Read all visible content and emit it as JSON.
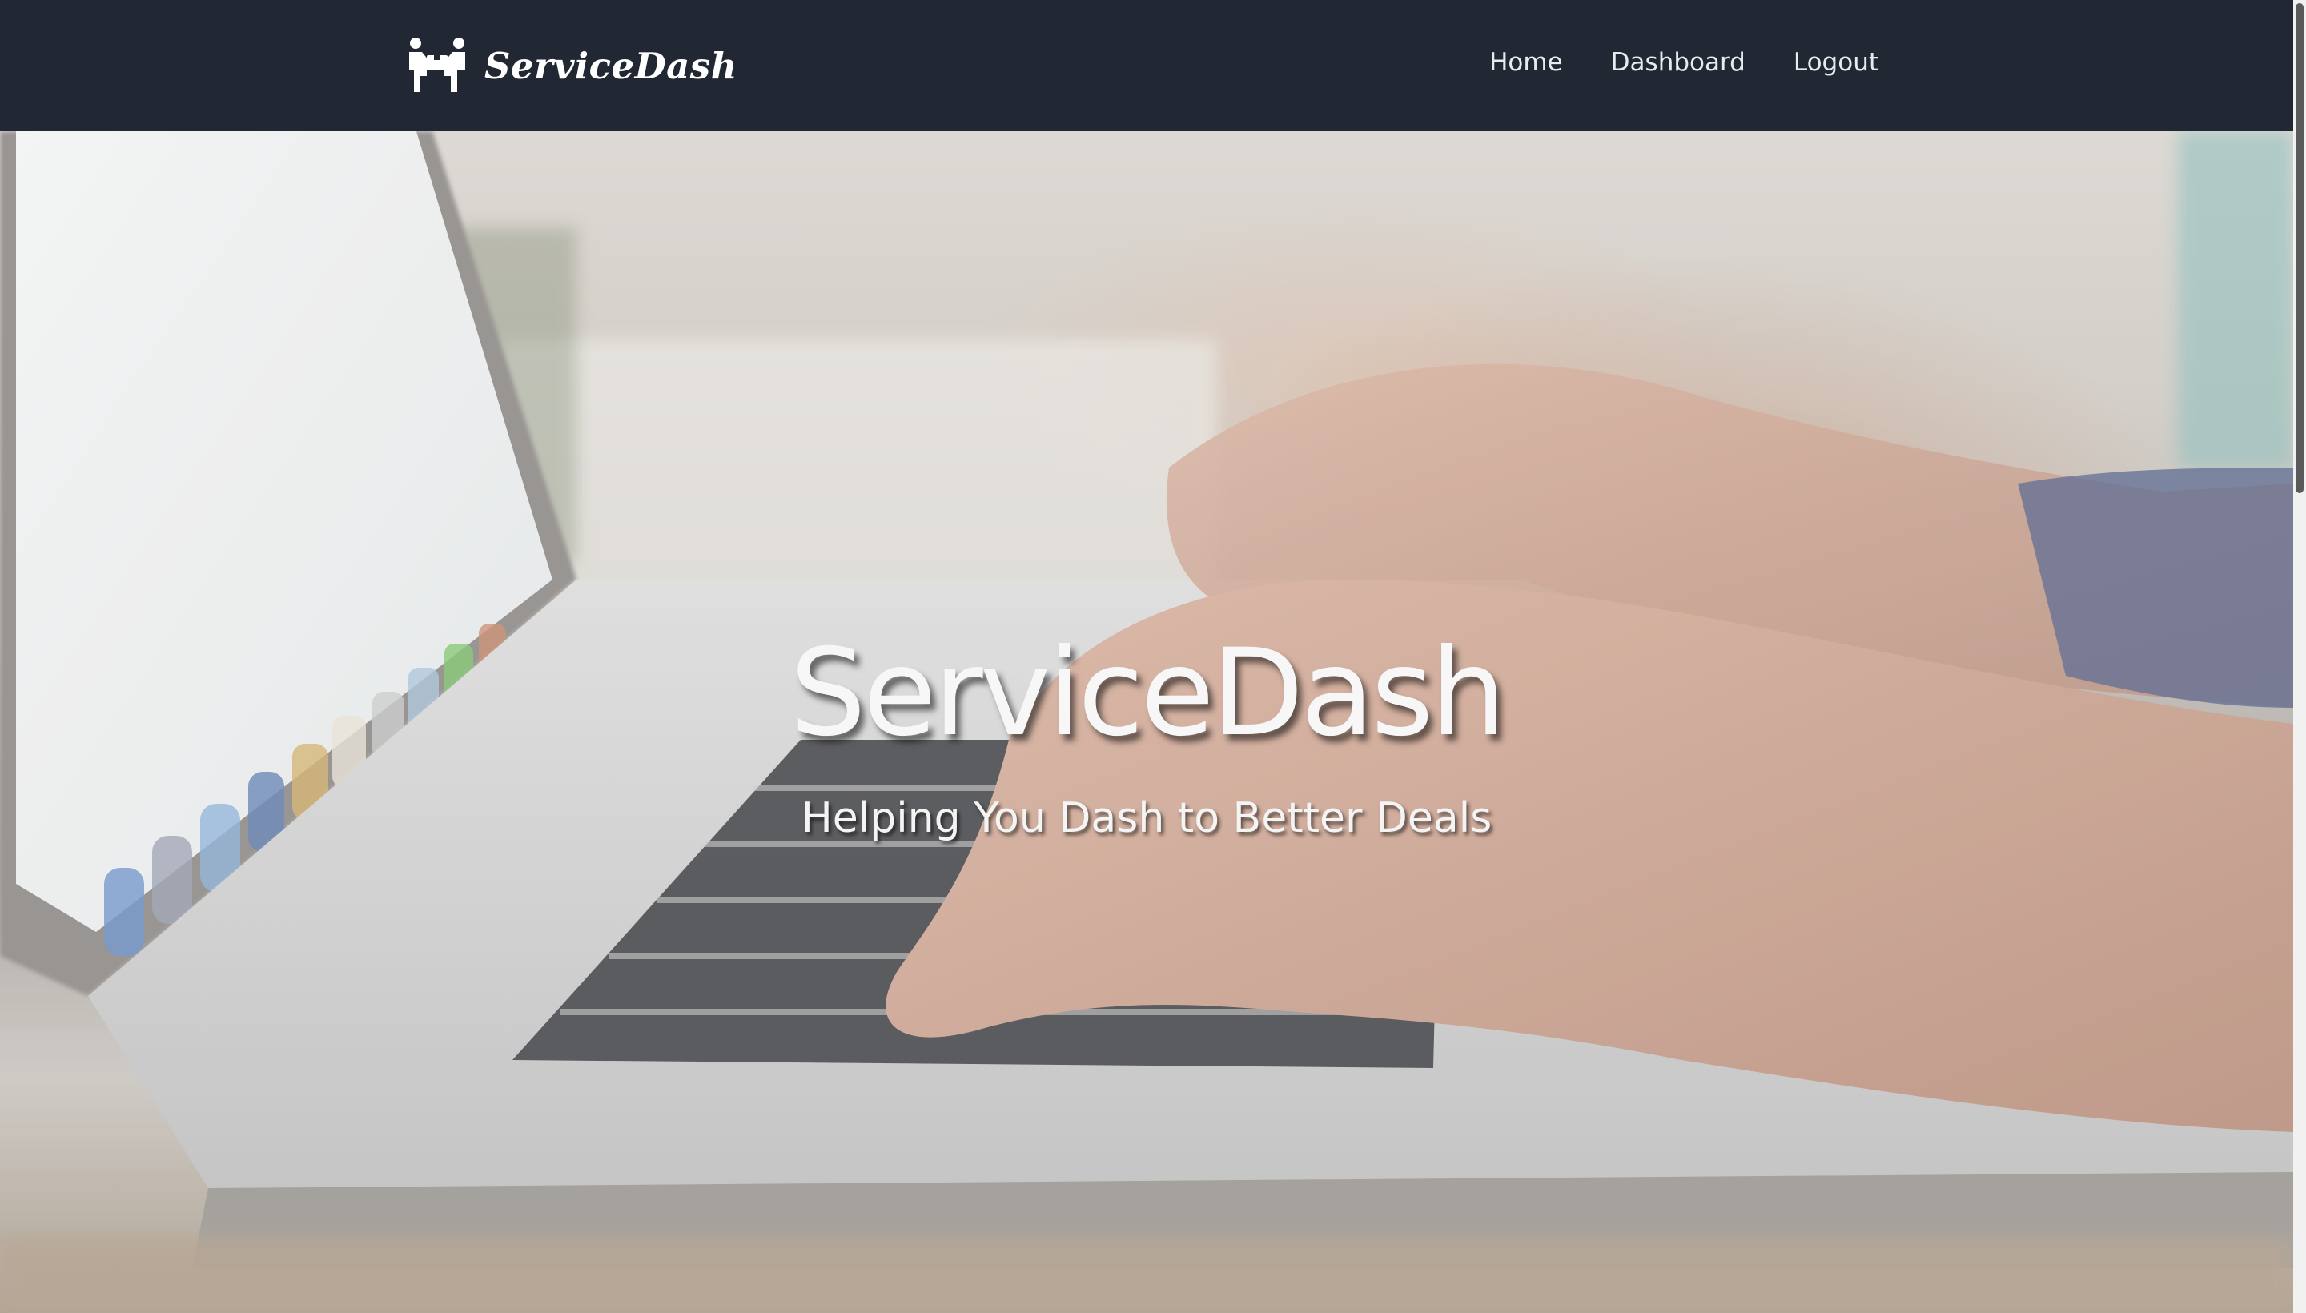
{
  "navbar": {
    "brand_name": "ServiceDash",
    "brand_icon": "people-carrying-box-icon",
    "links": [
      {
        "label": "Home"
      },
      {
        "label": "Dashboard"
      },
      {
        "label": "Logout"
      }
    ]
  },
  "hero": {
    "title": "ServiceDash",
    "subtitle": "Helping You Dash to Better Deals",
    "background_image": "hands-typing-on-laptop-photo"
  },
  "colors": {
    "navbar_bg": "#212733",
    "nav_text": "#e8eaee",
    "hero_text": "#f7f7f7"
  }
}
